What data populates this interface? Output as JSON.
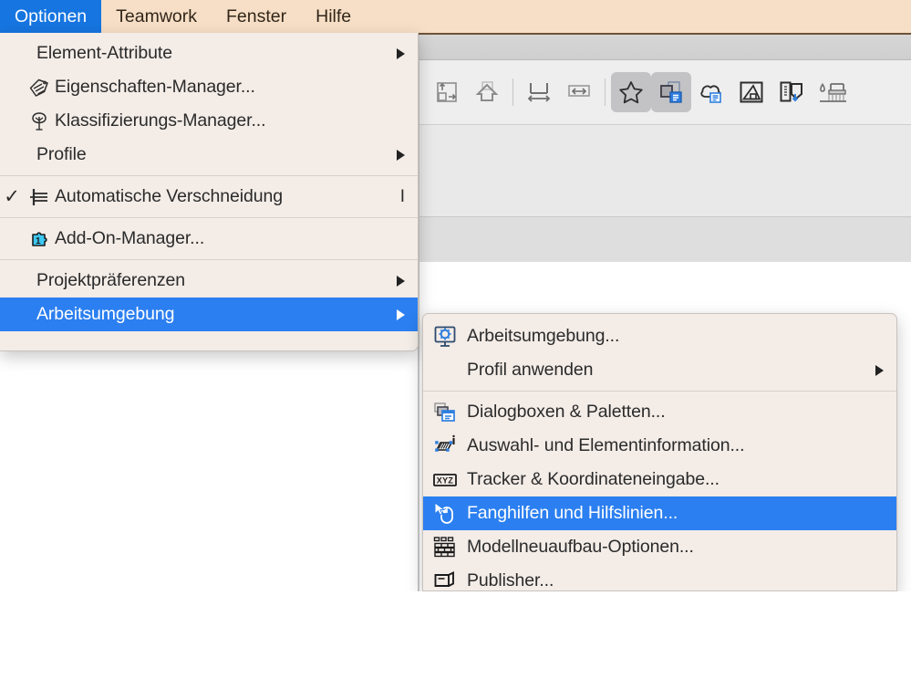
{
  "app": {
    "accent_blue": "#1675e0",
    "highlight_blue": "#2b7ff0",
    "menubar_bg": "#f6dfc6",
    "menu_bg": "#f3ece7"
  },
  "menubar": {
    "items": [
      {
        "label": "Optionen",
        "active": true
      },
      {
        "label": "Teamwork",
        "active": false
      },
      {
        "label": "Fenster",
        "active": false
      },
      {
        "label": "Hilfe",
        "active": false
      }
    ]
  },
  "toolbar": {
    "buttons": [
      {
        "name": "fit-in-window-icon",
        "active": false
      },
      {
        "name": "home-view-icon",
        "active": false
      },
      {
        "name": "separator-1",
        "active": false
      },
      {
        "name": "vertical-dimension-icon",
        "active": false
      },
      {
        "name": "horizontal-dimension-icon",
        "active": false
      },
      {
        "name": "separator-2",
        "active": false
      },
      {
        "name": "favorites-star-icon",
        "active": true
      },
      {
        "name": "element-settings-icon",
        "active": true
      },
      {
        "name": "cloud-list-icon",
        "active": false
      },
      {
        "name": "section-view-icon",
        "active": false
      },
      {
        "name": "info-edit-icon",
        "active": false
      },
      {
        "name": "paint-roller-icon",
        "active": false
      }
    ]
  },
  "optionen_menu": {
    "items": [
      {
        "label": "Element-Attribute",
        "icon": null,
        "arrow": true,
        "shortcut": null,
        "checked": false,
        "selected": false
      },
      {
        "label": "Eigenschaften-Manager...",
        "icon": "tag-icon",
        "arrow": false,
        "shortcut": null,
        "checked": false,
        "selected": false
      },
      {
        "label": "Klassifizierungs-Manager...",
        "icon": "tree-icon",
        "arrow": false,
        "shortcut": null,
        "checked": false,
        "selected": false
      },
      {
        "label": "Profile",
        "icon": null,
        "arrow": true,
        "shortcut": null,
        "checked": false,
        "selected": false
      },
      {
        "separator": true
      },
      {
        "label": "Automatische Verschneidung",
        "icon": "intersection-icon",
        "arrow": false,
        "shortcut": "I",
        "checked": true,
        "selected": false
      },
      {
        "separator": true
      },
      {
        "label": "Add-On-Manager...",
        "icon": "puzzle-icon",
        "arrow": false,
        "shortcut": null,
        "checked": false,
        "selected": false
      },
      {
        "separator": true
      },
      {
        "label": "Projektpräferenzen",
        "icon": null,
        "arrow": true,
        "shortcut": null,
        "checked": false,
        "selected": false
      },
      {
        "label": "Arbeitsumgebung",
        "icon": null,
        "arrow": true,
        "shortcut": null,
        "checked": false,
        "selected": true
      }
    ]
  },
  "arbeitsumgebung_submenu": {
    "items": [
      {
        "label": "Arbeitsumgebung...",
        "icon": "workspace-monitor-icon",
        "arrow": false,
        "selected": false
      },
      {
        "label": "Profil anwenden",
        "icon": null,
        "arrow": true,
        "selected": false
      },
      {
        "separator": true
      },
      {
        "label": "Dialogboxen & Paletten...",
        "icon": "dialog-palettes-icon",
        "arrow": false,
        "selected": false
      },
      {
        "label": "Auswahl- und Elementinformation...",
        "icon": "selection-info-icon",
        "arrow": false,
        "selected": false
      },
      {
        "label": "Tracker & Koordinateneingabe...",
        "icon": "xyz-tracker-icon",
        "arrow": false,
        "selected": false
      },
      {
        "label": "Fanghilfen und Hilfslinien...",
        "icon": "mouse-snap-icon",
        "arrow": false,
        "selected": true
      },
      {
        "label": "Modellneuaufbau-Optionen...",
        "icon": "brick-wall-icon",
        "arrow": false,
        "selected": false
      },
      {
        "label": "Publisher...",
        "icon": "publisher-icon",
        "arrow": false,
        "selected": false
      }
    ]
  }
}
